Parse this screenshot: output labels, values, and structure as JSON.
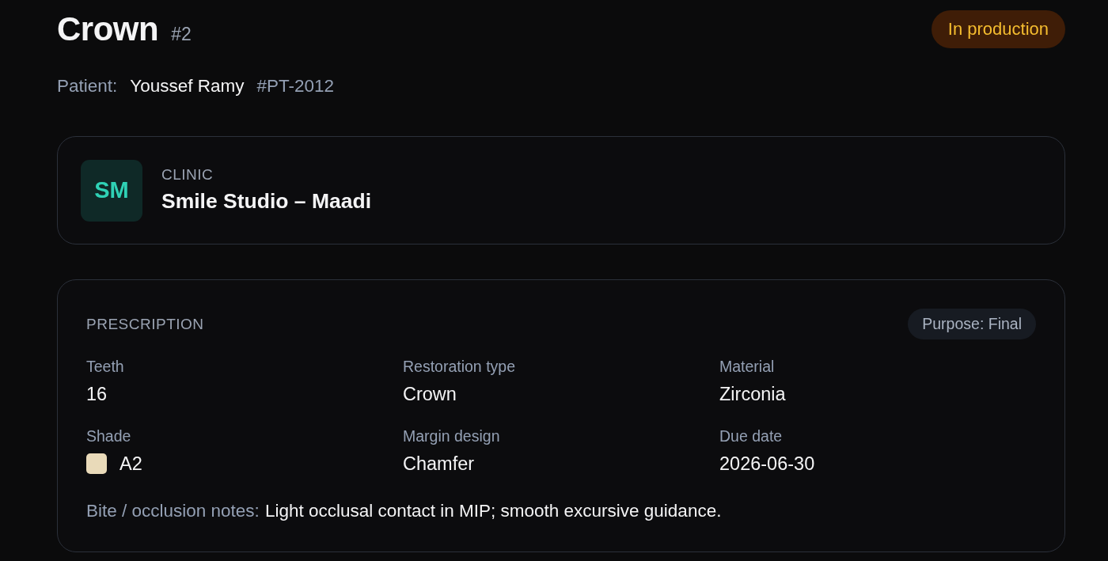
{
  "header": {
    "title": "Crown",
    "number": "#2",
    "status": {
      "label": "In production",
      "kind": "in_production"
    }
  },
  "patient": {
    "label": "Patient:",
    "name": "Youssef Ramy",
    "id": "#PT-2012"
  },
  "clinic": {
    "initials": "SM",
    "label": "CLINIC",
    "name": "Smile Studio – Maadi"
  },
  "prescription": {
    "title": "PRESCRIPTION",
    "purpose": "Purpose: Final",
    "fields": [
      {
        "kind": "text",
        "label": "Teeth",
        "value": "16"
      },
      {
        "kind": "text",
        "label": "Restoration type",
        "value": "Crown"
      },
      {
        "kind": "text",
        "label": "Material",
        "value": "Zirconia"
      },
      {
        "kind": "swatch",
        "label": "Shade",
        "value": "A2",
        "color": "#e9dab9"
      },
      {
        "kind": "text",
        "label": "Margin design",
        "value": "Chamfer"
      },
      {
        "kind": "text",
        "label": "Due date",
        "value": "2026-06-30"
      }
    ],
    "notes": {
      "label": "Bite / occlusion notes:",
      "text": "Light occlusal contact in MIP; smooth excursive guidance."
    }
  }
}
